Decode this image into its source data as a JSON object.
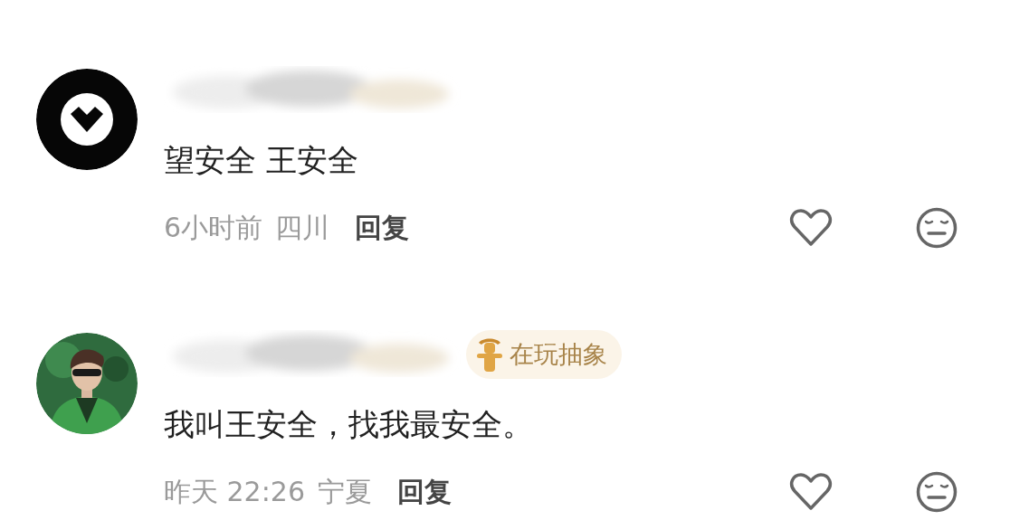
{
  "comments": [
    {
      "avatar": {
        "kind": "logo"
      },
      "text": "望安全 王安全",
      "time": "6小时前",
      "location": "四川",
      "reply": "回复"
    },
    {
      "badge": {
        "text": "在玩抽象"
      },
      "text": "我叫王安全，找我最安全。",
      "time": "昨天 22:26",
      "location": "宁夏",
      "reply": "回复"
    }
  ]
}
